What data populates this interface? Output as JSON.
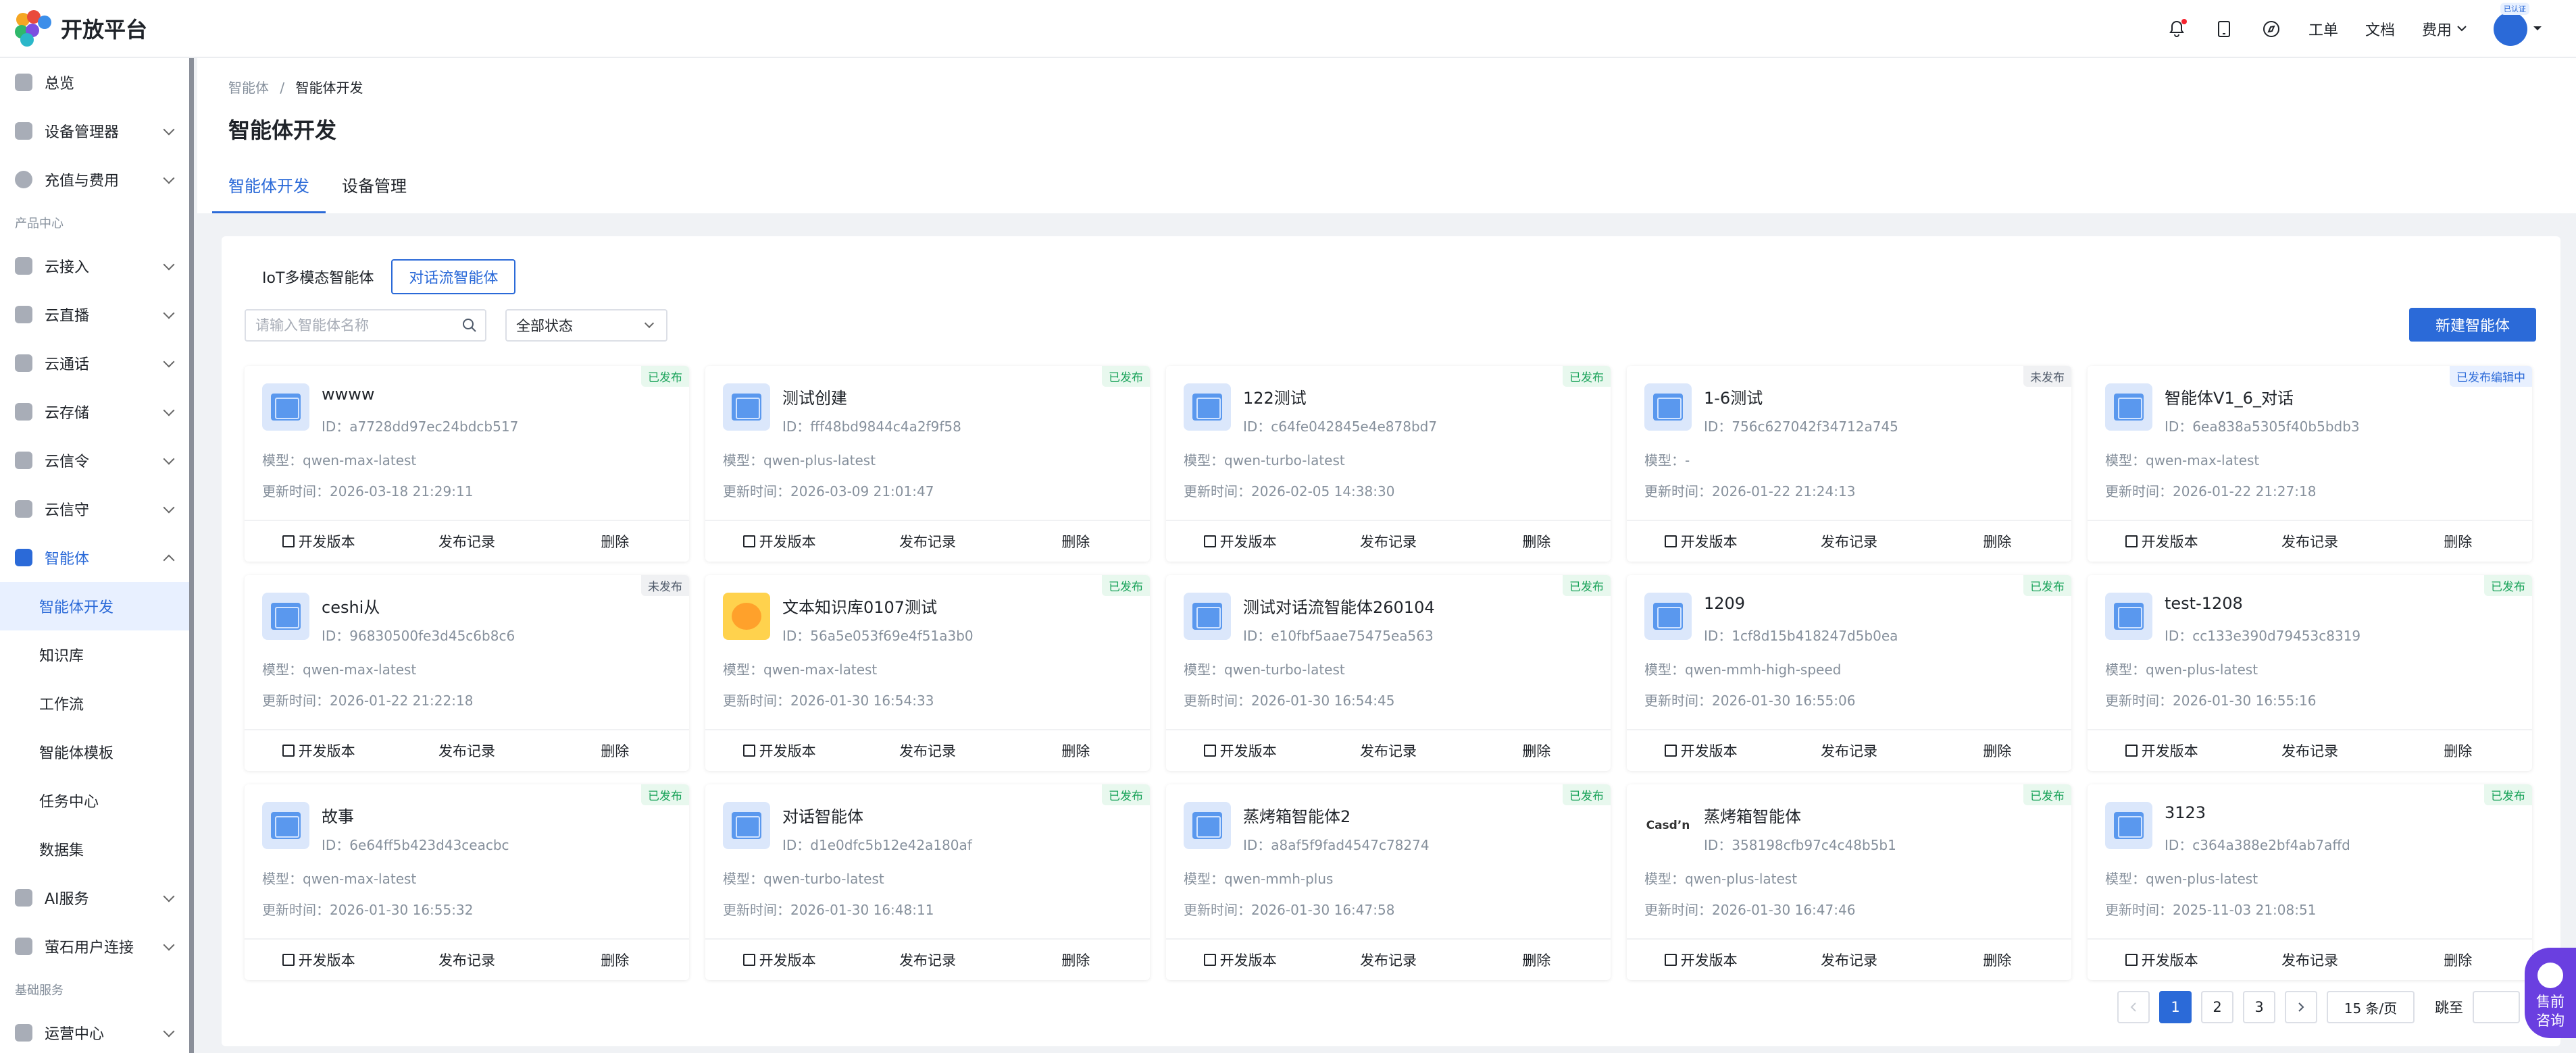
{
  "header": {
    "logo_text": "开放平台",
    "links": [
      "工单",
      "文档",
      "费用"
    ],
    "avatar_badge": "已认证"
  },
  "sidebar": {
    "items": [
      {
        "label": "总览"
      },
      {
        "label": "设备管理器"
      },
      {
        "label": "充值与费用"
      }
    ],
    "group_product": "产品中心",
    "product_items": [
      {
        "label": "云接入"
      },
      {
        "label": "云直播"
      },
      {
        "label": "云通话"
      },
      {
        "label": "云存储"
      },
      {
        "label": "云信令"
      },
      {
        "label": "云信守"
      },
      {
        "label": "智能体"
      }
    ],
    "agent_sub": [
      "智能体开发",
      "知识库",
      "工作流",
      "智能体模板",
      "任务中心",
      "数据集"
    ],
    "more_items": [
      {
        "label": "AI服务"
      },
      {
        "label": "萤石用户连接"
      }
    ],
    "group_base": "基础服务",
    "base_items": [
      {
        "label": "运营中心"
      }
    ]
  },
  "main": {
    "breadcrumb": [
      "智能体",
      "智能体开发"
    ],
    "breadcrumb_sep": "/",
    "title": "智能体开发",
    "tabs": [
      "智能体开发",
      "设备管理"
    ],
    "segments": [
      "IoT多模态智能体",
      "对话流智能体"
    ],
    "search_placeholder": "请输入智能体名称",
    "status_select": "全部状态",
    "new_button": "新建智能体",
    "model_label": "模型：",
    "time_label": "更新时间：",
    "actions": [
      "开发版本",
      "发布记录",
      "删除"
    ],
    "cards": [
      {
        "name": "wwww",
        "id": "ID：a7728dd97ec24bdcb517",
        "model": "qwen-max-latest",
        "time": "2026-03-18 21:29:11",
        "status": "已发布",
        "stype": "pub"
      },
      {
        "name": "测试创建",
        "id": "ID：fff48bd9844c4a2f9f58",
        "model": "qwen-plus-latest",
        "time": "2026-03-09 21:01:47",
        "status": "已发布",
        "stype": "pub"
      },
      {
        "name": "122测试",
        "id": "ID：c64fe042845e4e878bd7",
        "model": "qwen-turbo-latest",
        "time": "2026-02-05 14:38:30",
        "status": "已发布",
        "stype": "pub"
      },
      {
        "name": "1-6测试",
        "id": "ID：756c627042f34712a745",
        "model": "-",
        "time": "2026-01-22 21:24:13",
        "status": "未发布",
        "stype": "unpub"
      },
      {
        "name": "智能体V1_6_对话",
        "id": "ID：6ea838a5305f40b5bdb3",
        "model": "qwen-max-latest",
        "time": "2026-01-22 21:27:18",
        "status": "已发布编辑中",
        "stype": "editing"
      },
      {
        "name": "ceshi从",
        "id": "ID：96830500fe3d45c6b8c6",
        "model": "qwen-max-latest",
        "time": "2026-01-22 21:22:18",
        "status": "未发布",
        "stype": "unpub"
      },
      {
        "name": "文本知识库0107测试",
        "id": "ID：56a5e053f69e4f51a3b0",
        "model": "qwen-max-latest",
        "time": "2026-01-30 16:54:33",
        "status": "已发布",
        "stype": "pub",
        "icon": "special"
      },
      {
        "name": "测试对话流智能体260104",
        "id": "ID：e10fbf5aae75475ea563",
        "model": "qwen-turbo-latest",
        "time": "2026-01-30 16:54:45",
        "status": "已发布",
        "stype": "pub"
      },
      {
        "name": "1209",
        "id": "ID：1cf8d15b418247d5b0ea",
        "model": "qwen-mmh-high-speed",
        "time": "2026-01-30 16:55:06",
        "status": "已发布",
        "stype": "pub"
      },
      {
        "name": "test-1208",
        "id": "ID：cc133e390d79453c8319",
        "model": "qwen-plus-latest",
        "time": "2026-01-30 16:55:16",
        "status": "已发布",
        "stype": "pub"
      },
      {
        "name": "故事",
        "id": "ID：6e64ff5b423d43ceacbc",
        "model": "qwen-max-latest",
        "time": "2026-01-30 16:55:32",
        "status": "已发布",
        "stype": "pub"
      },
      {
        "name": "对话智能体",
        "id": "ID：d1e0dfc5b12e42a180af",
        "model": "qwen-turbo-latest",
        "time": "2026-01-30 16:48:11",
        "status": "已发布",
        "stype": "pub"
      },
      {
        "name": "蒸烤箱智能体2",
        "id": "ID：a8af5f9fad4547c78274",
        "model": "qwen-mmh-plus",
        "time": "2026-01-30 16:47:58",
        "status": "已发布",
        "stype": "pub"
      },
      {
        "name": "蒸烤箱智能体",
        "id": "ID：358198cfb97c4c48b5b1",
        "model": "qwen-plus-latest",
        "time": "2026-01-30 16:47:46",
        "status": "已发布",
        "stype": "pub",
        "icon": "brand",
        "brand_text": "Casd’n"
      },
      {
        "name": "3123",
        "id": "ID：c364a388e2bf4ab7affd",
        "model": "qwen-plus-latest",
        "time": "2025-11-03 21:08:51",
        "status": "已发布",
        "stype": "pub"
      }
    ],
    "pagination": {
      "pages": [
        "1",
        "2",
        "3"
      ],
      "current": "1",
      "page_size": "15 条/页",
      "jump_label": "跳至"
    }
  },
  "float": {
    "line1": "售前",
    "line2": "咨询"
  },
  "colors": {
    "accent": "#2b6ad8",
    "published": "#1aa35a"
  }
}
